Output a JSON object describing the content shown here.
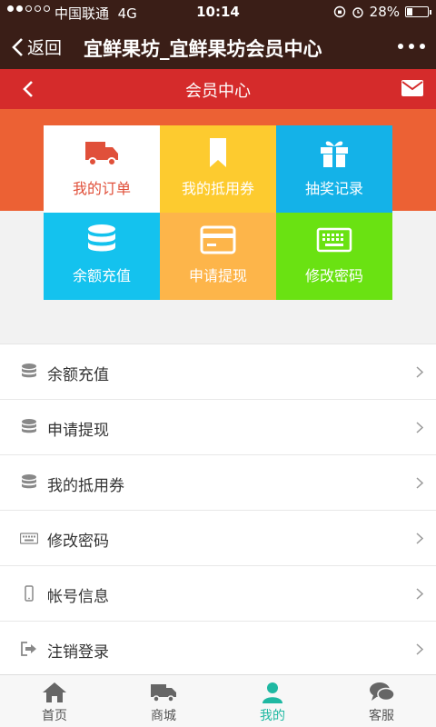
{
  "status_bar": {
    "carrier": "中国联通",
    "network": "4G",
    "time": "10:14",
    "battery": "28%",
    "battery_level": 0.28
  },
  "title_bar": {
    "back_label": "返回",
    "title": "宜鲜果坊_宜鲜果坊会员中心"
  },
  "header": {
    "title": "会员中心"
  },
  "grid": [
    {
      "label": "我的订单",
      "icon": "truck-icon",
      "color": "#ffffff"
    },
    {
      "label": "我的抵用券",
      "icon": "bookmark-icon",
      "color": "#fdcb2f"
    },
    {
      "label": "抽奖记录",
      "icon": "gift-icon",
      "color": "#14b2e8"
    },
    {
      "label": "余额充值",
      "icon": "database-icon",
      "color": "#14c2ee"
    },
    {
      "label": "申请提现",
      "icon": "credit-card-icon",
      "color": "#fdb54a"
    },
    {
      "label": "修改密码",
      "icon": "keyboard-icon",
      "color": "#6ae212"
    }
  ],
  "list": [
    {
      "label": "余额充值",
      "icon": "database-icon"
    },
    {
      "label": "申请提现",
      "icon": "database-icon"
    },
    {
      "label": "我的抵用券",
      "icon": "database-icon"
    },
    {
      "label": "修改密码",
      "icon": "keyboard-icon"
    },
    {
      "label": "帐号信息",
      "icon": "mobile-icon"
    },
    {
      "label": "注销登录",
      "icon": "sign-out-icon"
    }
  ],
  "bottom_nav": [
    {
      "label": "首页",
      "icon": "home-icon",
      "active": false
    },
    {
      "label": "商城",
      "icon": "truck-icon",
      "active": false
    },
    {
      "label": "我的",
      "icon": "user-icon",
      "active": true
    },
    {
      "label": "客服",
      "icon": "chat-icon",
      "active": false
    }
  ],
  "colors": {
    "title_bar": "#3a1e17",
    "header_red": "#d52b2b",
    "orange_band": "#ec6134",
    "active_nav": "#1fb8a2"
  }
}
